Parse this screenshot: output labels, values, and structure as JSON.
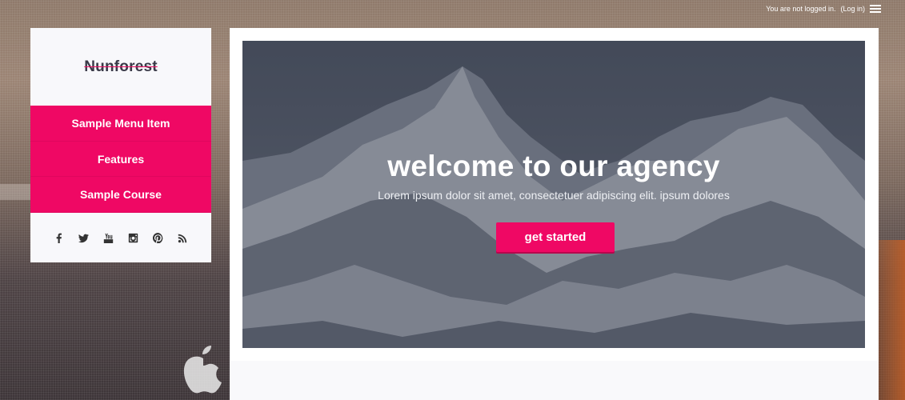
{
  "topbar": {
    "status_text": "You are not logged in.",
    "login_link": "(Log in)",
    "menu_icon": "menu-icon"
  },
  "sidebar": {
    "brand": "Nunforest",
    "nav_items": [
      {
        "label": "Sample Menu Item"
      },
      {
        "label": "Features"
      },
      {
        "label": "Sample Course"
      }
    ],
    "social_icons": [
      "facebook-icon",
      "twitter-icon",
      "youtube-icon",
      "instagram-icon",
      "pinterest-icon",
      "rss-icon"
    ]
  },
  "hero": {
    "title": "welcome to our agency",
    "subtitle": "Lorem ipsum dolor sit amet, consectetuer adipiscing elit. ipsum dolores",
    "cta_label": "get started"
  },
  "colors": {
    "accent": "#ef0864",
    "panel_bg": "#f8f8fb"
  }
}
